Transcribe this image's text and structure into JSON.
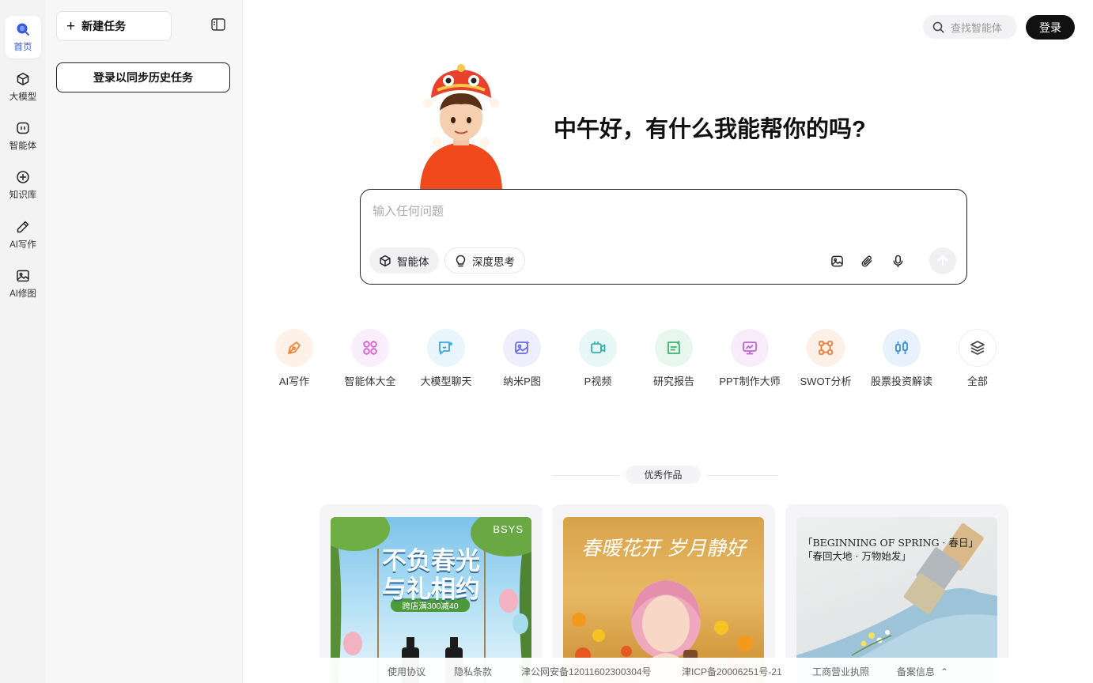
{
  "rail": {
    "items": [
      {
        "label": "首页",
        "icon": "home-icon"
      },
      {
        "label": "大模型",
        "icon": "cube-icon"
      },
      {
        "label": "智能体",
        "icon": "agent-icon"
      },
      {
        "label": "知识库",
        "icon": "knowledge-icon"
      },
      {
        "label": "AI写作",
        "icon": "pen-icon"
      },
      {
        "label": "AI修图",
        "icon": "image-icon"
      }
    ]
  },
  "panel": {
    "new_task": "新建任务",
    "login_sync": "登录以同步历史任务"
  },
  "header": {
    "search_placeholder": "查找智能体",
    "login": "登录"
  },
  "hero": {
    "greeting": "中午好，有什么我能帮你的吗?"
  },
  "chat": {
    "placeholder": "输入任何问题",
    "agent_chip": "智能体",
    "think_chip": "深度思考"
  },
  "shortcuts": [
    {
      "label": "AI写作",
      "color": "#f0843c",
      "bg": "#fff1e8"
    },
    {
      "label": "智能体大全",
      "color": "#d45fd0",
      "bg": "#fbeefb"
    },
    {
      "label": "大模型聊天",
      "color": "#3aa7e0",
      "bg": "#e9f5fc"
    },
    {
      "label": "纳米P图",
      "color": "#6a6fe0",
      "bg": "#eeeefc"
    },
    {
      "label": "P视频",
      "color": "#31b3a8",
      "bg": "#e7f7f5"
    },
    {
      "label": "研究报告",
      "color": "#3cb46e",
      "bg": "#e8f7ee"
    },
    {
      "label": "PPT制作大师",
      "color": "#c060d8",
      "bg": "#f8ecfb"
    },
    {
      "label": "SWOT分析",
      "color": "#f07e3a",
      "bg": "#fdf0e7"
    },
    {
      "label": "股票投资解读",
      "color": "#3a8ee0",
      "bg": "#e8f2fc"
    },
    {
      "label": "全部",
      "color": "#444444",
      "bg": "#f3f3f4"
    }
  ],
  "featured": {
    "title": "优秀作品",
    "cards": [
      {
        "brand": "BSYS",
        "headline1": "不负春光",
        "headline2": "与礼相约",
        "promo": "跨店满300减40"
      },
      {
        "headline": "春暖花开 岁月静好"
      },
      {
        "line1": "「BEGINNING OF SPRING · 春日」",
        "line2": "「春回大地 · 万物始发」"
      }
    ]
  },
  "footer": {
    "terms": "使用协议",
    "privacy": "隐私条款",
    "police": "津公网安备12011602300304号",
    "icp": "津ICP备20006251号-21",
    "license": "工商营业执照",
    "filing": "备案信息"
  }
}
